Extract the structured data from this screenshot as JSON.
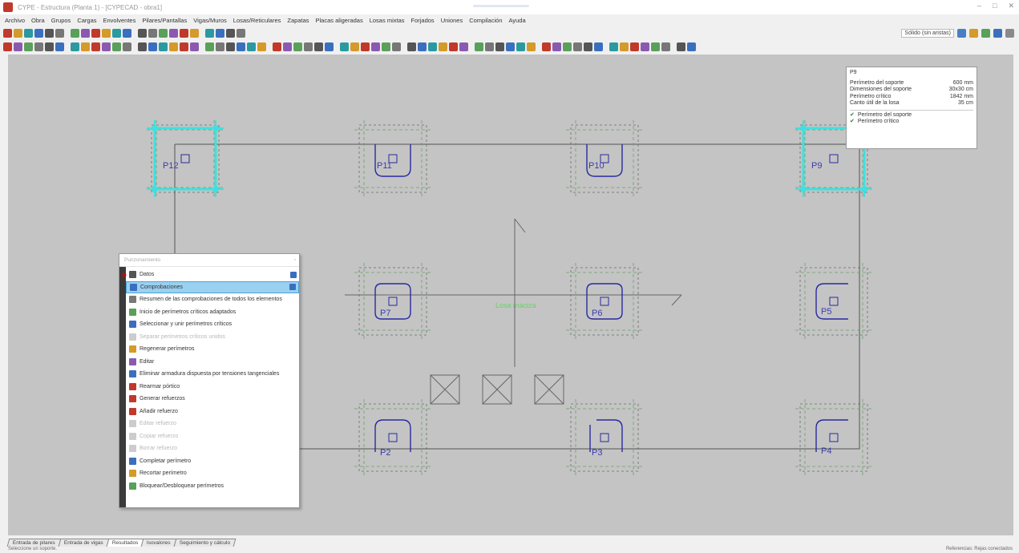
{
  "window": {
    "title": "CYPE - Estructura (Planta 1) - [CYPECAD - obra1]",
    "controls": [
      "–",
      "□",
      "✕"
    ]
  },
  "menu": [
    "Archivo",
    "Obra",
    "Grupos",
    "Cargas",
    "Envolventes",
    "Pilares/Pantallas",
    "Vigas/Muros",
    "Losas/Reticulares",
    "Zapatas",
    "Placas aligeradas",
    "Losas mixtas",
    "Forjados",
    "Uniones",
    "Compilación",
    "Ayuda"
  ],
  "right_toolbar": {
    "render_select": "Sólido (sin aristas)"
  },
  "info_popup": {
    "header": "P9",
    "rows": [
      {
        "label": "Perímetro del soporte",
        "value": "600 mm"
      },
      {
        "label": "Dimensiones del soporte",
        "value": "30x30 cm"
      },
      {
        "label": "Perímetro crítico",
        "value": "1842 mm"
      },
      {
        "label": "Canto útil de la losa",
        "value": "35 cm"
      }
    ],
    "checks": [
      "Perímetro del soporte",
      "Perímetro crítico"
    ]
  },
  "columns": [
    {
      "label": "P12"
    },
    {
      "label": "P11"
    },
    {
      "label": "P10"
    },
    {
      "label": "P9"
    },
    {
      "label": "P7"
    },
    {
      "label": "P6"
    },
    {
      "label": "P5"
    },
    {
      "label": "P2"
    },
    {
      "label": "P3"
    },
    {
      "label": "P4"
    }
  ],
  "slab_label": "Losa maciza",
  "context_menu": {
    "title": "Punzonamiento",
    "items": [
      {
        "label": "Datos",
        "disabled": false,
        "selected": false,
        "icon": "table-icon",
        "has_submenu": true
      },
      {
        "label": "Comprobaciones",
        "disabled": false,
        "selected": true,
        "icon": "check-icon",
        "has_submenu": true
      },
      {
        "label": "Resumen de las comprobaciones de todos los elementos",
        "disabled": false,
        "selected": false,
        "icon": "document-icon",
        "has_submenu": false
      },
      {
        "label": "Inicio de perímetros críticos adaptados",
        "disabled": false,
        "selected": false,
        "icon": "perimeter-icon",
        "has_submenu": false
      },
      {
        "label": "Seleccionar y unir perímetros críticos",
        "disabled": false,
        "selected": false,
        "icon": "select-icon",
        "has_submenu": false
      },
      {
        "label": "Separar perímetros críticos unidos",
        "disabled": true,
        "selected": false,
        "icon": "split-icon",
        "has_submenu": false
      },
      {
        "label": "Regenerar perímetros",
        "disabled": false,
        "selected": false,
        "icon": "regenerate-icon",
        "has_submenu": false
      },
      {
        "label": "Editar",
        "disabled": false,
        "selected": false,
        "icon": "edit-icon",
        "has_submenu": false
      },
      {
        "label": "Eliminar armadura dispuesta por tensiones tangenciales",
        "disabled": false,
        "selected": false,
        "icon": "delete-rebar-icon",
        "has_submenu": false
      },
      {
        "label": "Rearmar pórtico",
        "disabled": false,
        "selected": false,
        "icon": "rearm-icon",
        "has_submenu": false
      },
      {
        "label": "Generar refuerzos",
        "disabled": false,
        "selected": false,
        "icon": "generate-icon",
        "has_submenu": false
      },
      {
        "label": "Añadir refuerzo",
        "disabled": false,
        "selected": false,
        "icon": "add-icon",
        "has_submenu": false
      },
      {
        "label": "Editar refuerzo",
        "disabled": true,
        "selected": false,
        "icon": "edit-rebar-icon",
        "has_submenu": false
      },
      {
        "label": "Copiar refuerzo",
        "disabled": true,
        "selected": false,
        "icon": "copy-icon",
        "has_submenu": false
      },
      {
        "label": "Borrar refuerzo",
        "disabled": true,
        "selected": false,
        "icon": "erase-icon",
        "has_submenu": false
      },
      {
        "label": "Completar perímetro",
        "disabled": false,
        "selected": false,
        "icon": "complete-icon",
        "has_submenu": false
      },
      {
        "label": "Recortar perímetro",
        "disabled": false,
        "selected": false,
        "icon": "trim-icon",
        "has_submenu": false
      },
      {
        "label": "Bloquear/Desbloquear perímetros",
        "disabled": false,
        "selected": false,
        "icon": "lock-icon",
        "has_submenu": false
      }
    ]
  },
  "tabs": [
    {
      "label": "Entrada de pilares",
      "active": false
    },
    {
      "label": "Entrada de vigas",
      "active": false
    },
    {
      "label": "Resultados",
      "active": true
    },
    {
      "label": "Isovalores",
      "active": false
    },
    {
      "label": "Seguimiento y cálculo",
      "active": false
    }
  ],
  "status": {
    "left": "Seleccione un soporte.",
    "right": "Referencias: Rejas conectados"
  },
  "colors": {
    "viewport_bg": "#c4c4c4",
    "perimeter": "#2a2aa0",
    "selection": "#40e0e0",
    "selected_menu": "#9ad0f0"
  }
}
